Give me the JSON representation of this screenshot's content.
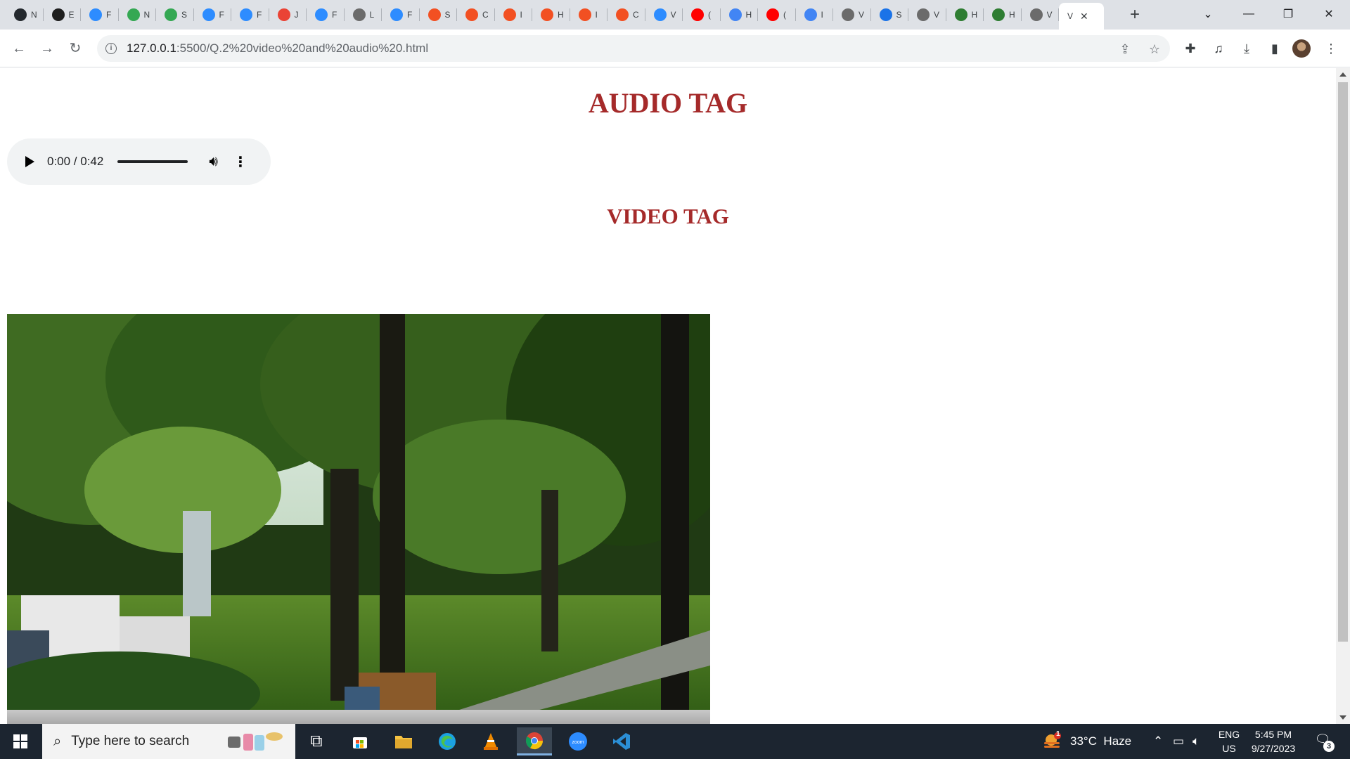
{
  "browser": {
    "tabs": [
      {
        "icon": "github-icon",
        "letter": "N",
        "color": "#24292e"
      },
      {
        "icon": "wordpress-icon",
        "letter": "E",
        "color": "#1e1e1e"
      },
      {
        "icon": "zoom-icon",
        "letter": "F",
        "color": "#2d8cff"
      },
      {
        "icon": "google-drive-icon",
        "letter": "N",
        "color": "#34a853"
      },
      {
        "icon": "google-drive-icon",
        "letter": "S",
        "color": "#34a853"
      },
      {
        "icon": "zoom-icon",
        "letter": "F",
        "color": "#2d8cff"
      },
      {
        "icon": "zoom-icon",
        "letter": "F",
        "color": "#2d8cff"
      },
      {
        "icon": "gmail-icon",
        "letter": "J",
        "color": "#ea4335"
      },
      {
        "icon": "zoom-icon",
        "letter": "F",
        "color": "#2d8cff"
      },
      {
        "icon": "globe-icon",
        "letter": "L",
        "color": "#6b6b6b"
      },
      {
        "icon": "zoom-icon",
        "letter": "F",
        "color": "#2d8cff"
      },
      {
        "icon": "microsoft-icon",
        "letter": "S",
        "color": "#f25022"
      },
      {
        "icon": "microsoft-icon",
        "letter": "C",
        "color": "#f25022"
      },
      {
        "icon": "microsoft-icon",
        "letter": "I",
        "color": "#f25022"
      },
      {
        "icon": "microsoft-icon",
        "letter": "H",
        "color": "#f25022"
      },
      {
        "icon": "microsoft-icon",
        "letter": "I",
        "color": "#f25022"
      },
      {
        "icon": "microsoft-icon",
        "letter": "C",
        "color": "#f25022"
      },
      {
        "icon": "zoom-icon",
        "letter": "V",
        "color": "#2d8cff"
      },
      {
        "icon": "youtube-icon",
        "letter": "(",
        "color": "#ff0000"
      },
      {
        "icon": "google-icon",
        "letter": "H",
        "color": "#4285f4"
      },
      {
        "icon": "youtube-icon",
        "letter": "(",
        "color": "#ff0000"
      },
      {
        "icon": "google-icon",
        "letter": "I",
        "color": "#4285f4"
      },
      {
        "icon": "globe-icon",
        "letter": "V",
        "color": "#6b6b6b"
      },
      {
        "icon": "drop-icon",
        "letter": "S",
        "color": "#1a73e8"
      },
      {
        "icon": "globe-icon",
        "letter": "V",
        "color": "#6b6b6b"
      },
      {
        "icon": "w-icon",
        "letter": "H",
        "color": "#2e7d32"
      },
      {
        "icon": "w-icon",
        "letter": "H",
        "color": "#2e7d32"
      },
      {
        "icon": "globe-icon",
        "letter": "V",
        "color": "#6b6b6b"
      }
    ],
    "active_tab_title": "V",
    "url_host": "127.0.0.1",
    "url_rest": ":5500/Q.2%20video%20and%20audio%20.html"
  },
  "page": {
    "audio_heading": "AUDIO TAG",
    "video_heading": "VIDEO TAG",
    "audio_time": "0:00 / 0:42"
  },
  "taskbar": {
    "search_placeholder": "Type here to search",
    "weather": "33°C  Haze",
    "weather_badge": "1",
    "lang_top": "ENG",
    "lang_bottom": "US",
    "time": "5:45 PM",
    "date": "9/27/2023",
    "notifications": "3"
  }
}
